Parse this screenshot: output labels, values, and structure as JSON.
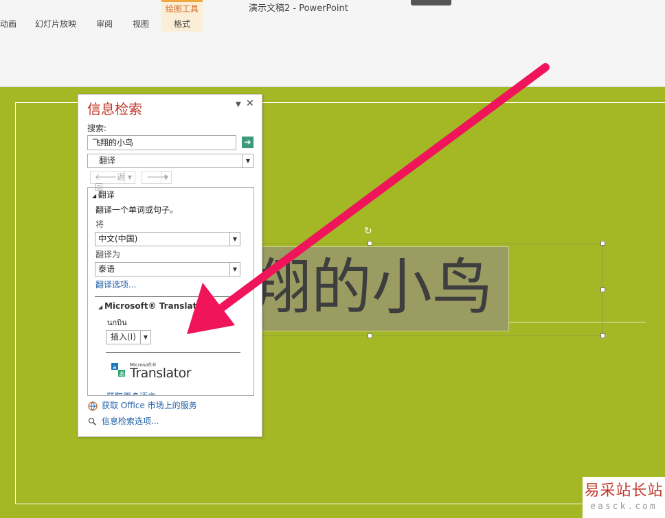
{
  "window_title": "演示文稿2 - PowerPoint",
  "ribbon": {
    "tabs": [
      "动画",
      "幻灯片放映",
      "审阅",
      "视图"
    ],
    "context_group_title": "绘图工具",
    "context_tab": "格式"
  },
  "slide": {
    "title_text": "翔的小鸟"
  },
  "research_pane": {
    "title": "信息检索",
    "menu_icon": "▼",
    "close_icon": "✕",
    "search_label": "搜索:",
    "search_value": "飞翔的小鸟",
    "service_selected": "翻译",
    "back_label": "返回",
    "results": {
      "header": "翻译",
      "description": "翻译一个单词或句子。",
      "from_label": "将",
      "from_value": "中文(中国)",
      "to_label": "翻译为",
      "to_value": "泰语",
      "options_link": "翻译选项...",
      "provider_header": "Microsoft® Translator",
      "result_word": "นกบิน",
      "insert_button": "插入(I)",
      "logo_small": "Microsoft®",
      "logo_text": "Translator",
      "more_languages": "获取更多语言"
    },
    "market_link": "获取 Office 市场上的服务",
    "options_link": "信息检索选项..."
  },
  "watermark": {
    "cn": "易采站长站",
    "en": "easck.com"
  },
  "colors": {
    "slide_bg": "#a4b826",
    "pane_title": "#c0392b",
    "arrow": "#f0145a",
    "link": "#1e5fa8"
  }
}
